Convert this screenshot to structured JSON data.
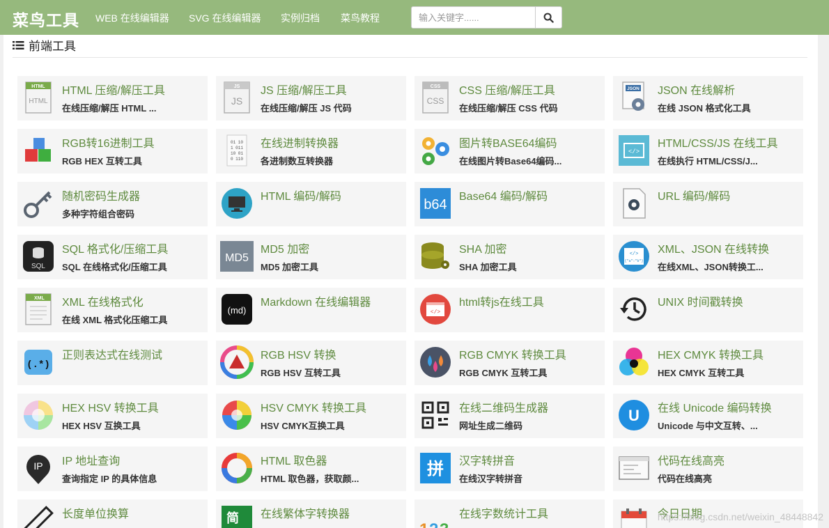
{
  "navbar": {
    "brand": "菜鸟工具",
    "links": [
      "WEB 在线编辑器",
      "SVG 在线编辑器",
      "实例归档",
      "菜鸟教程"
    ],
    "search_placeholder": "输入关键字......"
  },
  "section": {
    "title": "前端工具"
  },
  "tools": [
    {
      "title": "HTML 压缩/解压工具",
      "desc": "在线压缩/解压 HTML ...",
      "icon": "html-file-icon"
    },
    {
      "title": "JS 压缩/解压工具",
      "desc": "在线压缩/解压 JS 代码",
      "icon": "js-file-icon"
    },
    {
      "title": "CSS 压缩/解压工具",
      "desc": "在线压缩/解压 CSS 代码",
      "icon": "css-file-icon"
    },
    {
      "title": "JSON 在线解析",
      "desc": "在线 JSON 格式化工具",
      "icon": "json-gear-icon"
    },
    {
      "title": "RGB转16进制工具",
      "desc": "RGB HEX 互转工具",
      "icon": "rgb-cubes-icon"
    },
    {
      "title": "在线进制转换器",
      "desc": "各进制数互转换器",
      "icon": "binary-icon"
    },
    {
      "title": "图片转BASE64编码",
      "desc": "在线图片转Base64编码...",
      "icon": "gears-icon"
    },
    {
      "title": "HTML/CSS/JS 在线工具",
      "desc": "在线执行 HTML/CSS/J...",
      "icon": "code-window-icon"
    },
    {
      "title": "随机密码生成器",
      "desc": "多种字符组合密码",
      "icon": "key-icon"
    },
    {
      "title": "HTML 编码/解码",
      "desc": "",
      "icon": "monitor-icon"
    },
    {
      "title": "Base64 编码/解码",
      "desc": "",
      "icon": "b64-icon"
    },
    {
      "title": "URL 编码/解码",
      "desc": "",
      "icon": "url-file-icon"
    },
    {
      "title": "SQL 格式化/压缩工具",
      "desc": "SQL 在线格式化/压缩工具",
      "icon": "sql-icon"
    },
    {
      "title": "MD5 加密",
      "desc": "MD5 加密工具",
      "icon": "md5-icon"
    },
    {
      "title": "SHA 加密",
      "desc": "SHA 加密工具",
      "icon": "database-key-icon"
    },
    {
      "title": "XML、JSON 在线转换",
      "desc": "在线XML、JSON转换工...",
      "icon": "xml-json-icon"
    },
    {
      "title": "XML 在线格式化",
      "desc": "在线 XML 格式化压缩工具",
      "icon": "xml-file-icon"
    },
    {
      "title": "Markdown 在线编辑器",
      "desc": "",
      "icon": "markdown-icon"
    },
    {
      "title": "html转js在线工具",
      "desc": "",
      "icon": "html-js-icon"
    },
    {
      "title": "UNIX 时间戳转换",
      "desc": "",
      "icon": "clock-history-icon"
    },
    {
      "title": "正则表达式在线测试",
      "desc": "",
      "icon": "regex-icon"
    },
    {
      "title": "RGB HSV 转换",
      "desc": "RGB HSV 互转工具",
      "icon": "color-triangle-icon"
    },
    {
      "title": "RGB CMYK 转换工具",
      "desc": "RGB CMYK 互转工具",
      "icon": "color-drops-icon"
    },
    {
      "title": "HEX CMYK 转换工具",
      "desc": "HEX CMYK 互转工具",
      "icon": "cmyk-circles-icon"
    },
    {
      "title": "HEX HSV 转换工具",
      "desc": "HEX HSV 互换工具",
      "icon": "color-ball-icon"
    },
    {
      "title": "HSV CMYK 转换工具",
      "desc": "HSV CMYK互换工具",
      "icon": "color-wheel-icon"
    },
    {
      "title": "在线二维码生成器",
      "desc": "网址生成二维码",
      "icon": "qrcode-icon"
    },
    {
      "title": "在线 Unicode 编码转换",
      "desc": "Unicode 与中文互转、...",
      "icon": "unicode-icon"
    },
    {
      "title": "IP 地址查询",
      "desc": "查询指定 IP 的具体信息",
      "icon": "ip-pin-icon"
    },
    {
      "title": "HTML 取色器",
      "desc": "HTML 取色器，获取颜...",
      "icon": "color-ring-icon"
    },
    {
      "title": "汉字转拼音",
      "desc": "在线汉字转拼音",
      "icon": "pinyin-icon"
    },
    {
      "title": "代码在线高亮",
      "desc": "代码在线高亮",
      "icon": "code-highlight-icon"
    },
    {
      "title": "长度单位换算",
      "desc": "",
      "icon": "ruler-icon"
    },
    {
      "title": "在线繁体字转换器",
      "desc": "",
      "icon": "traditional-chinese-icon"
    },
    {
      "title": "在线字数统计工具",
      "desc": "",
      "icon": "word-count-icon"
    },
    {
      "title": "今日日期",
      "desc": "",
      "icon": "calendar-icon"
    }
  ],
  "watermark": "https://blog.csdn.net/weixin_48448842"
}
